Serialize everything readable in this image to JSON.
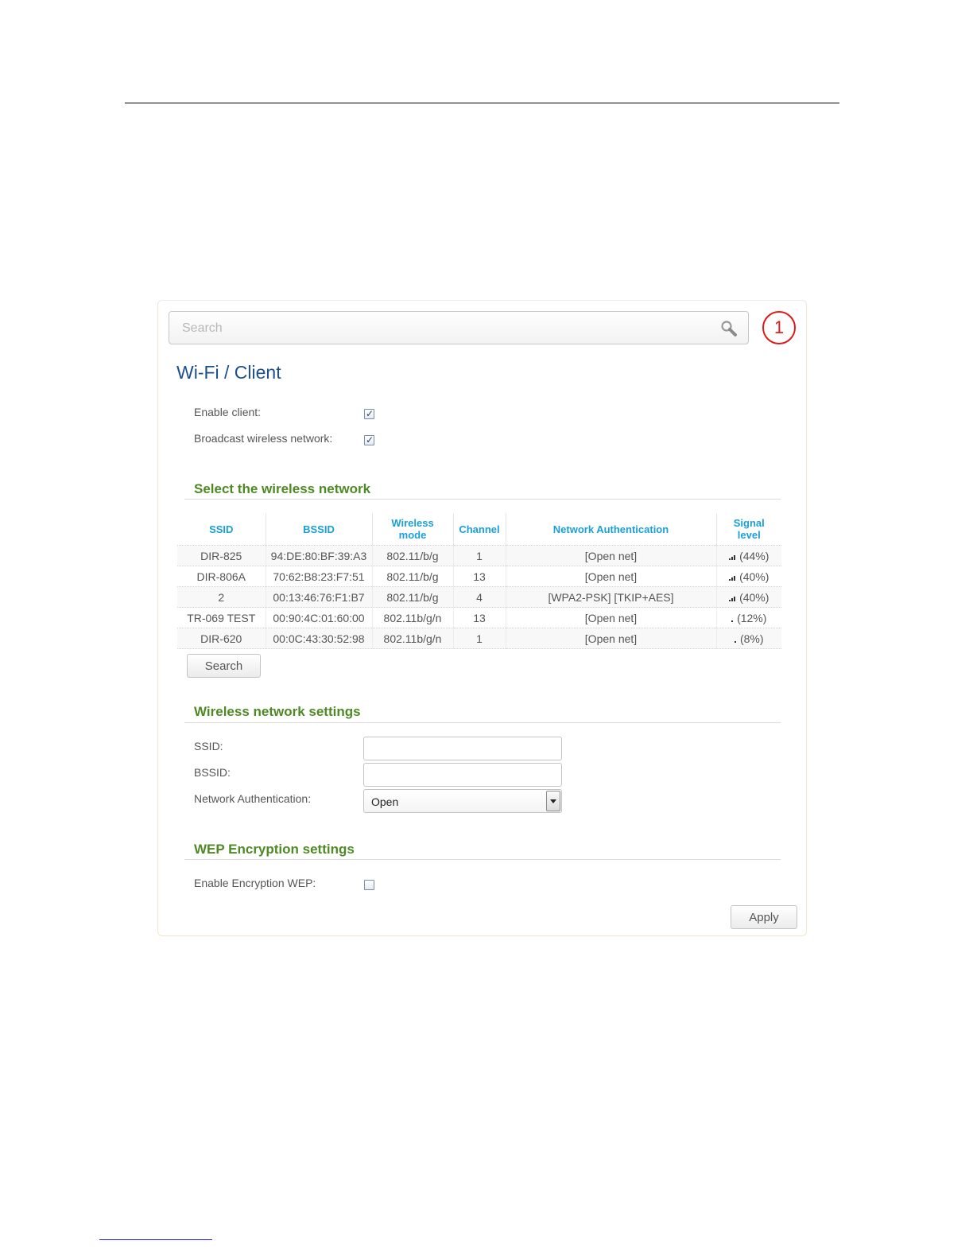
{
  "search": {
    "placeholder": "Search",
    "icon": "search-icon"
  },
  "callout": "1",
  "page": {
    "title": "Wi-Fi /  Client"
  },
  "client": {
    "enable_label": "Enable client:",
    "enable_checked": true,
    "broadcast_label": "Broadcast wireless network:",
    "broadcast_checked": true
  },
  "select_network": {
    "title": "Select the wireless network",
    "columns": {
      "ssid": "SSID",
      "bssid": "BSSID",
      "mode_line1": "Wireless",
      "mode_line2": "mode",
      "channel": "Channel",
      "auth": "Network Authentication",
      "signal_line1": "Signal",
      "signal_line2": "level"
    },
    "rows": [
      {
        "ssid": "DIR-825",
        "bssid": "94:DE:80:BF:39:A3",
        "mode": "802.11/b/g",
        "channel": "1",
        "auth": "[Open net]",
        "signal": "(44%)",
        "signal_level": 0.44
      },
      {
        "ssid": "DIR-806A",
        "bssid": "70:62:B8:23:F7:51",
        "mode": "802.11/b/g",
        "channel": "13",
        "auth": "[Open net]",
        "signal": "(40%)",
        "signal_level": 0.4
      },
      {
        "ssid": "2",
        "bssid": "00:13:46:76:F1:B7",
        "mode": "802.11/b/g",
        "channel": "4",
        "auth": "[WPA2-PSK] [TKIP+AES]",
        "signal": "(40%)",
        "signal_level": 0.4
      },
      {
        "ssid": "TR-069 TEST",
        "bssid": "00:90:4C:01:60:00",
        "mode": "802.11b/g/n",
        "channel": "13",
        "auth": "[Open net]",
        "signal": "(12%)",
        "signal_level": 0.12
      },
      {
        "ssid": "DIR-620",
        "bssid": "00:0C:43:30:52:98",
        "mode": "802.11b/g/n",
        "channel": "1",
        "auth": "[Open net]",
        "signal": "(8%)",
        "signal_level": 0.08
      }
    ],
    "search_button": "Search"
  },
  "wireless_settings": {
    "title": "Wireless network settings",
    "ssid_label": "SSID:",
    "ssid_value": "",
    "bssid_label": "BSSID:",
    "bssid_value": "",
    "auth_label": "Network Authentication:",
    "auth_value": "Open"
  },
  "wep": {
    "title": "WEP Encryption settings",
    "enable_label": "Enable Encryption WEP:",
    "enable_checked": false
  },
  "apply_button": "Apply",
  "colors": {
    "title": "#1c4f8e",
    "section": "#4e8a23",
    "table_header": "#1aa0d8",
    "callout": "#e01818"
  }
}
